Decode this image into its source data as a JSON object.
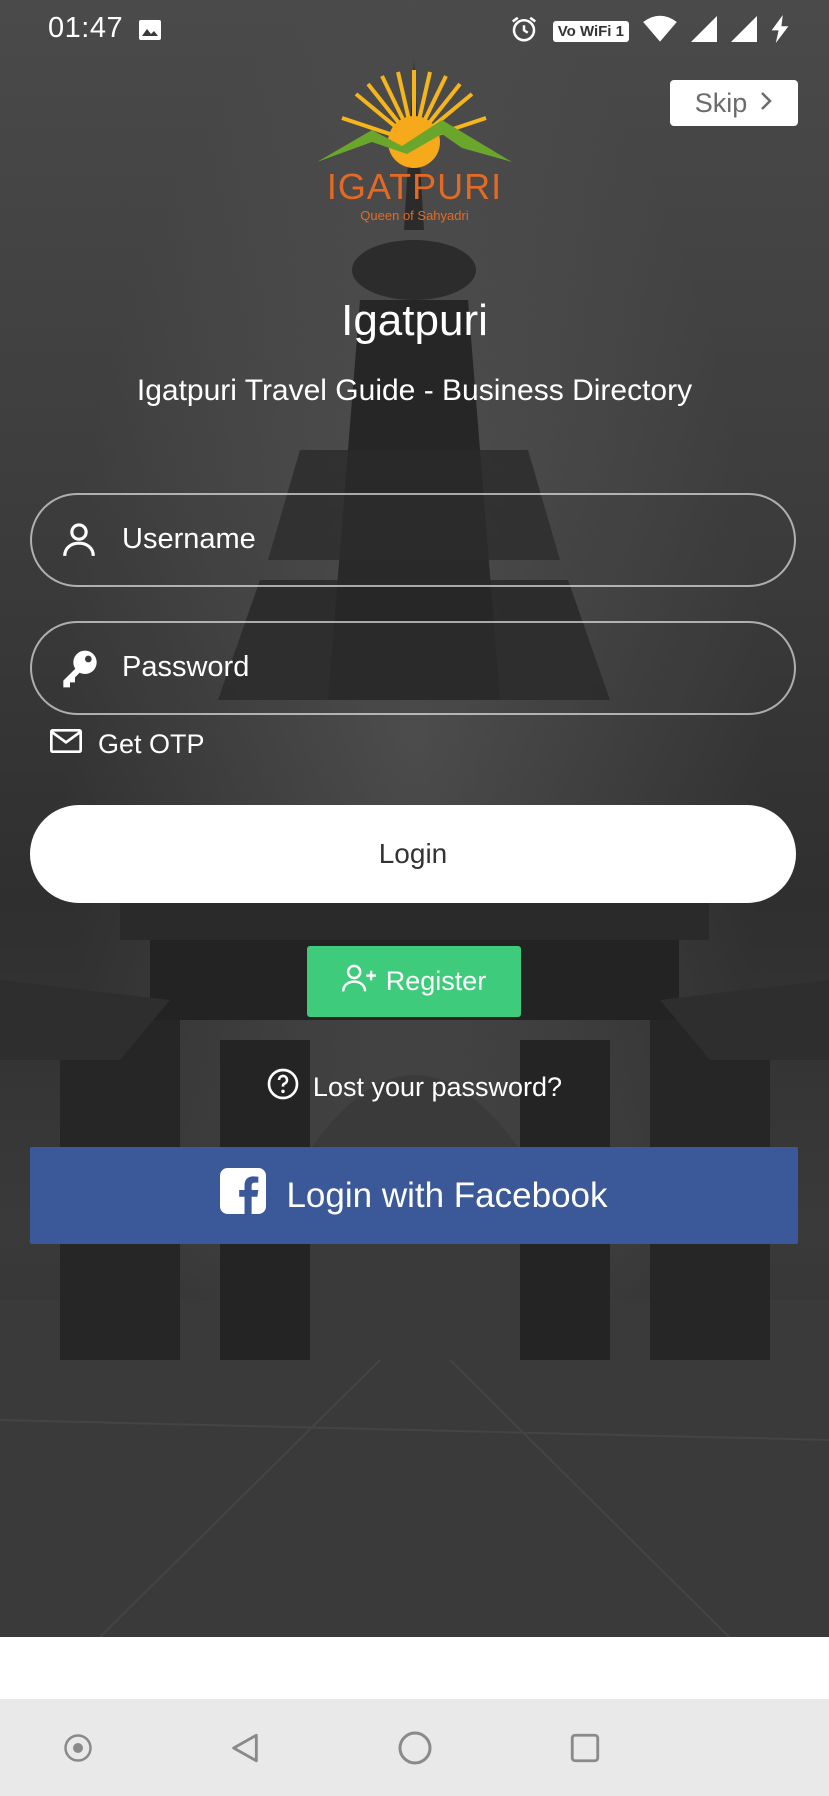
{
  "status_bar": {
    "time": "01:47",
    "network_badge": "Vo WiFi 1",
    "icons": [
      "image-icon",
      "alarm-icon",
      "wifi-icon",
      "signal-icon",
      "signal-icon",
      "charging-icon"
    ]
  },
  "skip": {
    "label": "Skip"
  },
  "logo": {
    "name": "IGATPURI",
    "tagline": "Queen of Sahyadri"
  },
  "header": {
    "title": "Igatpuri",
    "subtitle": "Igatpuri Travel Guide - Business Directory"
  },
  "form": {
    "username_placeholder": "Username",
    "password_placeholder": "Password",
    "otp_label": "Get OTP",
    "login_label": "Login",
    "register_label": "Register",
    "lost_password_label": "Lost your password?",
    "facebook_label": "Login with Facebook"
  },
  "colors": {
    "register_green": "#3ecb7c",
    "facebook_blue": "#3b5898",
    "logo_orange": "#e46a24"
  },
  "nav_bar": {
    "buttons": [
      "assistant-icon",
      "back-icon",
      "home-icon",
      "recents-icon"
    ]
  }
}
